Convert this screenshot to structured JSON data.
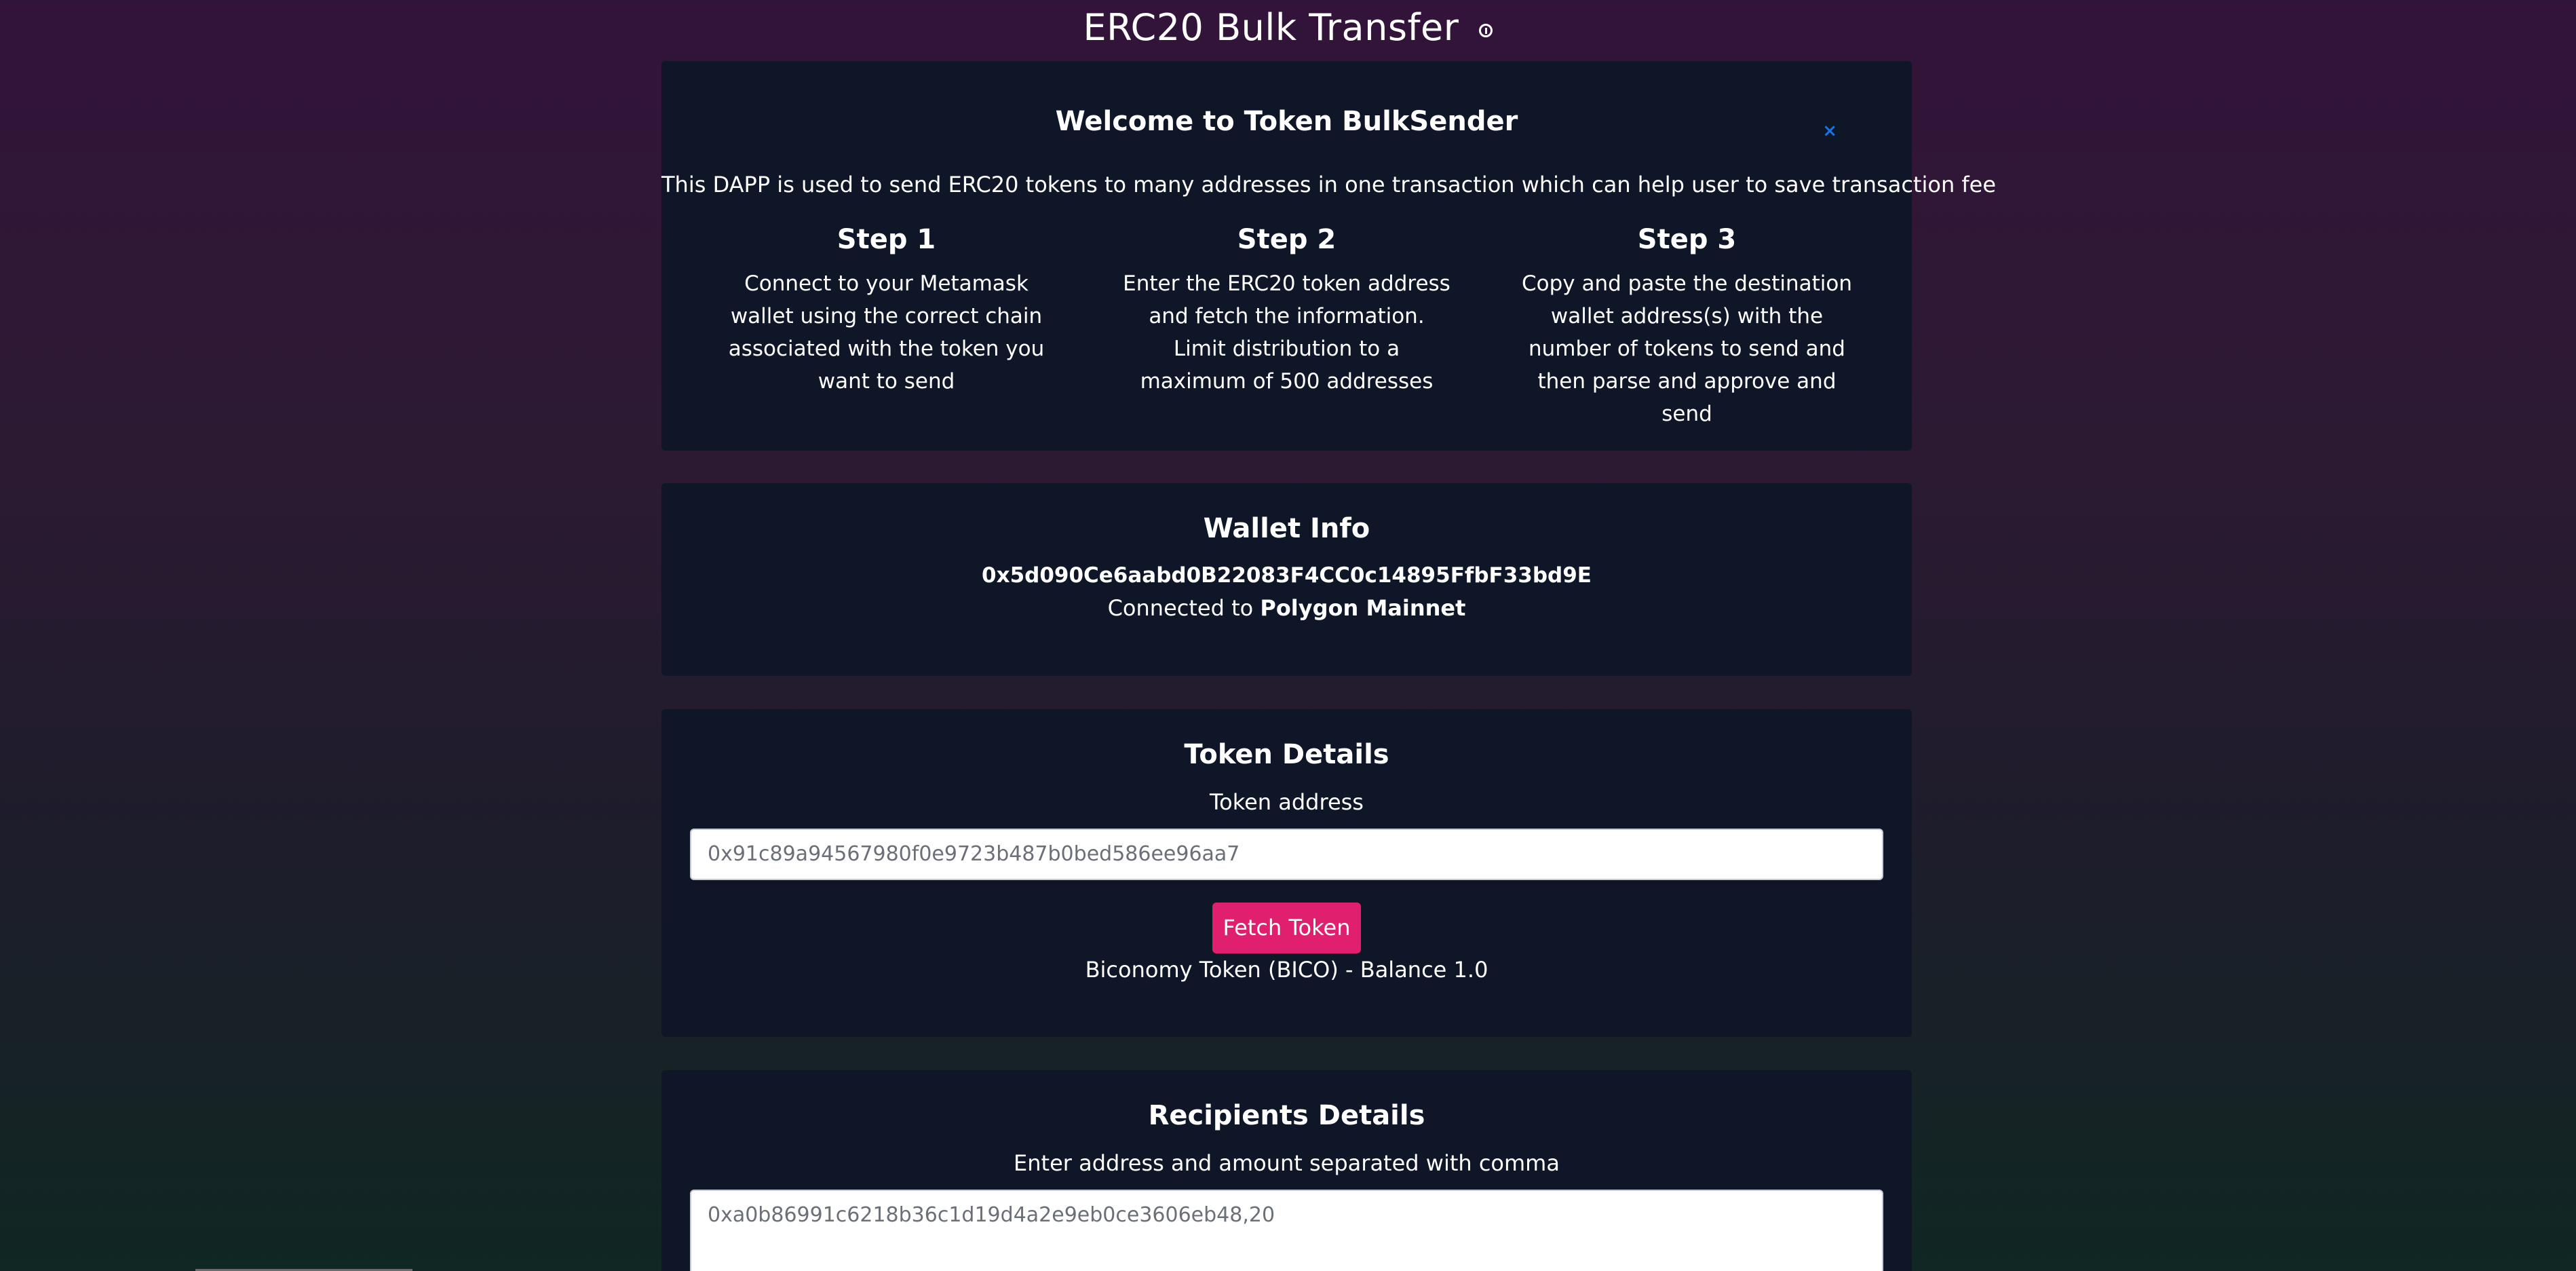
{
  "header": {
    "title": "ERC20 Bulk Transfer",
    "info_icon": "info-circle-icon"
  },
  "welcome": {
    "title": "Welcome to Token BulkSender",
    "close_label": "×",
    "description": "This DAPP is used to send ERC20 tokens to many addresses in one transaction which can help user to save transaction fee",
    "steps": [
      {
        "title": "Step 1",
        "text": "Connect to your Metamask wallet using the correct chain associated with the token you want to send"
      },
      {
        "title": "Step 2",
        "text": "Enter the ERC20 token address and fetch the information. Limit distribution to a maximum of 500 addresses"
      },
      {
        "title": "Step 3",
        "text": "Copy and paste the destination wallet address(s) with the number of tokens to send and then parse and approve and send"
      }
    ]
  },
  "wallet": {
    "title": "Wallet Info",
    "address": "0x5d090Ce6aabd0B22083F4CC0c14895FfbF33bd9E",
    "connected_prefix": "Connected to",
    "network": "Polygon Mainnet"
  },
  "token": {
    "title": "Token Details",
    "address_label": "Token address",
    "address_placeholder": "0x91c89a94567980f0e9723b487b0bed586ee96aa7",
    "fetch_button": "Fetch Token",
    "result": "Biconomy Token (BICO) - Balance 1.0"
  },
  "recipients": {
    "title": "Recipients Details",
    "instruction": "Enter address and amount separated with comma",
    "placeholder": "0xa0b86991c6218b36c1d19d4a2e9eb0ce3606eb48,20"
  },
  "colors": {
    "card_bg": "#0f1627",
    "accent": "#e0206e",
    "close_color": "#1a73e8"
  }
}
